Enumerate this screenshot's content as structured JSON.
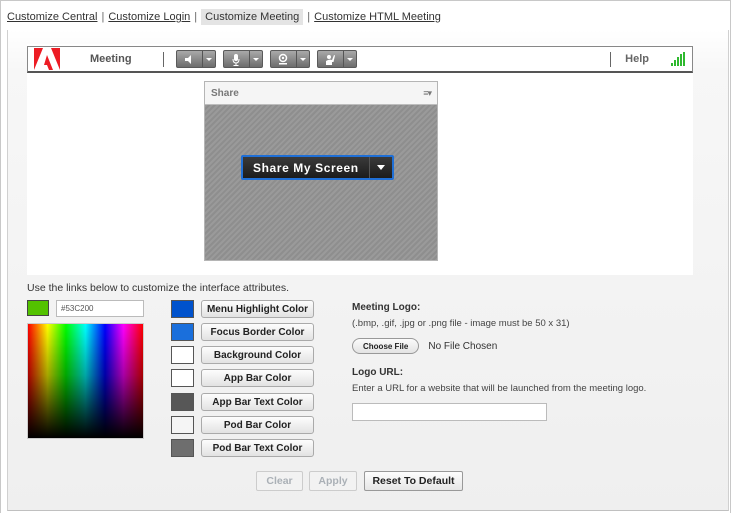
{
  "nav": {
    "links": [
      {
        "label": "Customize Central",
        "active": false
      },
      {
        "label": "Customize Login",
        "active": false
      },
      {
        "label": "Customize Meeting",
        "active": true
      },
      {
        "label": "Customize HTML Meeting",
        "active": false
      }
    ],
    "separator": "|"
  },
  "preview": {
    "app_bar": {
      "logo": "adobe-logo",
      "title": "Meeting",
      "tools": [
        {
          "name": "speaker",
          "icon": "speaker-icon"
        },
        {
          "name": "microphone",
          "icon": "microphone-icon"
        },
        {
          "name": "webcam",
          "icon": "webcam-icon"
        },
        {
          "name": "raise-hand",
          "icon": "raise-hand-icon"
        }
      ],
      "help_label": "Help",
      "signal_icon": "connection-signal-icon",
      "signal_color": "#2fb92f"
    },
    "share_pod": {
      "title": "Share",
      "menu_icon": "pod-menu-icon",
      "button_label": "Share My Screen",
      "focus_border_color": "#1f6fd6"
    }
  },
  "customize": {
    "instructions": "Use the links below to customize the interface attributes.",
    "current_color": "#53C200",
    "hex_value": "#53C200",
    "attributes": [
      {
        "label": "Menu Highlight Color",
        "color": "#0052cc"
      },
      {
        "label": "Focus Border Color",
        "color": "#1a6fdc"
      },
      {
        "label": "Background Color",
        "color": "#ffffff"
      },
      {
        "label": "App Bar Color",
        "color": "#ffffff"
      },
      {
        "label": "App Bar Text Color",
        "color": "#575757"
      },
      {
        "label": "Pod Bar Color",
        "color": "#f5f5f5"
      },
      {
        "label": "Pod Bar Text Color",
        "color": "#6e6e6e"
      }
    ]
  },
  "logo": {
    "label": "Meeting Logo:",
    "hint": "(.bmp, .gif, .jpg or .png file - image must be 50 x 31)",
    "choose_file_label": "Choose File",
    "file_status": "No File Chosen",
    "url_label": "Logo URL:",
    "url_hint": "Enter a URL for a website that will be launched from the meeting logo.",
    "url_value": ""
  },
  "actions": {
    "clear_label": "Clear",
    "apply_label": "Apply",
    "reset_label": "Reset To Default"
  }
}
